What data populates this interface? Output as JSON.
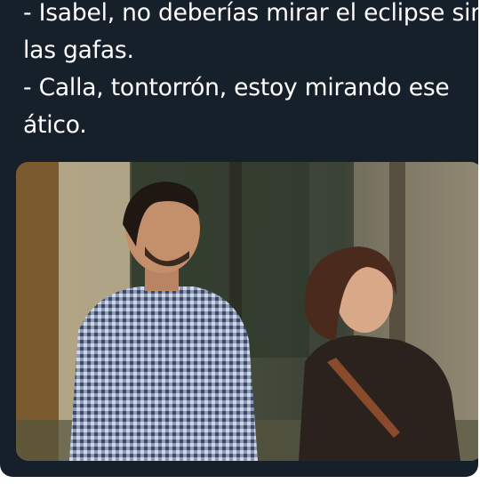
{
  "tweet": {
    "lines": [
      "- Isabel, no deberías mirar el eclipse sin",
      "las gafas.",
      "- Calla, tontorrón, estoy mirando ese",
      "ático."
    ]
  },
  "media": {
    "kind": "photo",
    "icon": "photo-of-man-and-woman-looking-up"
  },
  "colors": {
    "background": "#15202b",
    "text": "#ffffff"
  }
}
